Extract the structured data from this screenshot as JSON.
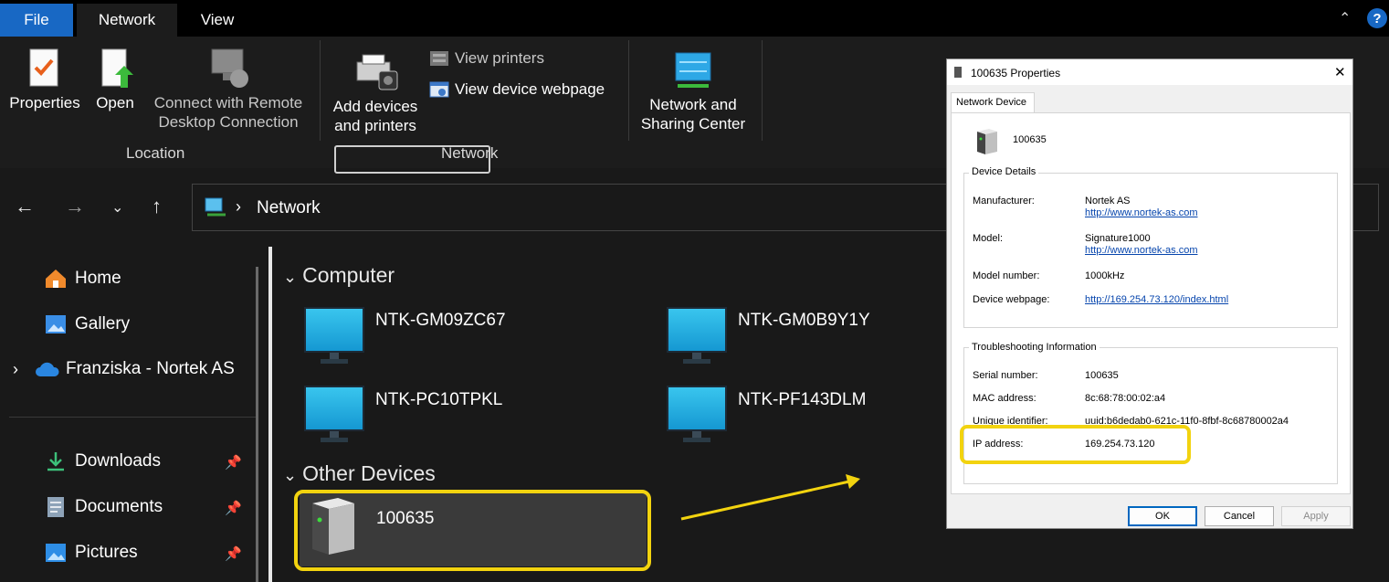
{
  "ribbon": {
    "tabs": [
      "File",
      "Network",
      "View"
    ],
    "properties": "Properties",
    "open": "Open",
    "connect_line1": "Connect with Remote",
    "connect_line2": "Desktop Connection",
    "add_line1": "Add devices",
    "add_line2": "and printers",
    "view_printers": "View printers",
    "view_webpage": "View device webpage",
    "nsc_line1": "Network and",
    "nsc_line2": "Sharing Center",
    "group_location": "Location",
    "group_network": "Network"
  },
  "address": {
    "path": "Network"
  },
  "sidebar": {
    "items": [
      "Home",
      "Gallery",
      "Franziska - Nortek AS",
      "Downloads",
      "Documents",
      "Pictures"
    ]
  },
  "content": {
    "group_computer": "Computer",
    "computers": [
      "NTK-GM09ZC67",
      "NTK-GM0B9Y1Y",
      "NTK-PC10TPKL",
      "NTK-PF143DLM"
    ],
    "group_other": "Other Devices",
    "device_name": "100635"
  },
  "dialog": {
    "title": "100635 Properties",
    "tab": "Network Device",
    "device_name": "100635",
    "details_title": "Device Details",
    "manufacturer_label": "Manufacturer:",
    "manufacturer_value": "Nortek AS",
    "manufacturer_link": "http://www.nortek-as.com",
    "model_label": "Model:",
    "model_value": "Signature1000",
    "model_link": "http://www.nortek-as.com",
    "model_number_label": "Model number:",
    "model_number_value": "1000kHz",
    "webpage_label": "Device webpage:",
    "webpage_link": "http://169.254.73.120/index.html",
    "trouble_title": "Troubleshooting Information",
    "serial_label": "Serial number:",
    "serial_value": "100635",
    "mac_label": "MAC address:",
    "mac_value": "8c:68:78:00:02:a4",
    "uid_label": "Unique identifier:",
    "uid_value": "uuid:b6dedab0-621c-11f0-8fbf-8c68780002a4",
    "ip_label": "IP address:",
    "ip_value": "169.254.73.120",
    "ok": "OK",
    "cancel": "Cancel",
    "apply": "Apply"
  },
  "colors": {
    "highlight": "#f2d30f",
    "file_tab": "#1868c4",
    "link": "#0645ad"
  }
}
